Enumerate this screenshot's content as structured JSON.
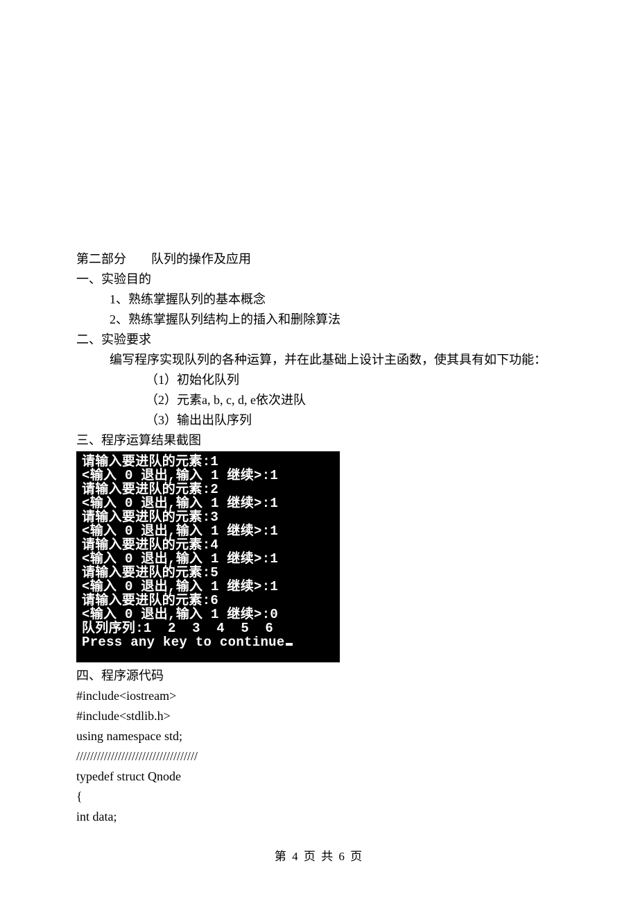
{
  "header": {
    "part_title": "第二部分　　队列的操作及应用"
  },
  "sec1": {
    "title": "一、实验目的",
    "item1": "1、熟练掌握队列的基本概念",
    "item2": "2、熟练掌握队列结构上的插入和删除算法"
  },
  "sec2": {
    "title": "二、实验要求",
    "intro": "编写程序实现队列的各种运算，并在此基础上设计主函数，使其具有如下功能：",
    "p1": "（1）初始化队列",
    "p2": "（2）元素a, b, c, d, e依次进队",
    "p3": "（3）输出出队序列"
  },
  "sec3": {
    "title": "三、程序运算结果截图"
  },
  "terminal": {
    "l01": "请输入要进队的元素:1",
    "l02": "<输入 0 退出,输入 1 继续>:1",
    "l03": "请输入要进队的元素:2",
    "l04": "<输入 0 退出,输入 1 继续>:1",
    "l05": "请输入要进队的元素:3",
    "l06": "<输入 0 退出,输入 1 继续>:1",
    "l07": "请输入要进队的元素:4",
    "l08": "<输入 0 退出,输入 1 继续>:1",
    "l09": "请输入要进队的元素:5",
    "l10": "<输入 0 退出,输入 1 继续>:1",
    "l11": "请输入要进队的元素:6",
    "l12": "<输入 0 退出,输入 1 继续>:0",
    "l13": "队列序列:1  2  3  4  5  6",
    "l14": "Press any key to continue"
  },
  "sec4": {
    "title": "四、程序源代码"
  },
  "code": {
    "l1": "#include<iostream>",
    "l2": "#include<stdlib.h>",
    "l3": "using namespace std;",
    "l4": "///////////////////////////////////",
    "l5": "typedef struct Qnode",
    "l6": "{",
    "l7": "int data;"
  },
  "footer": {
    "text": "第 4 页 共 6 页"
  }
}
